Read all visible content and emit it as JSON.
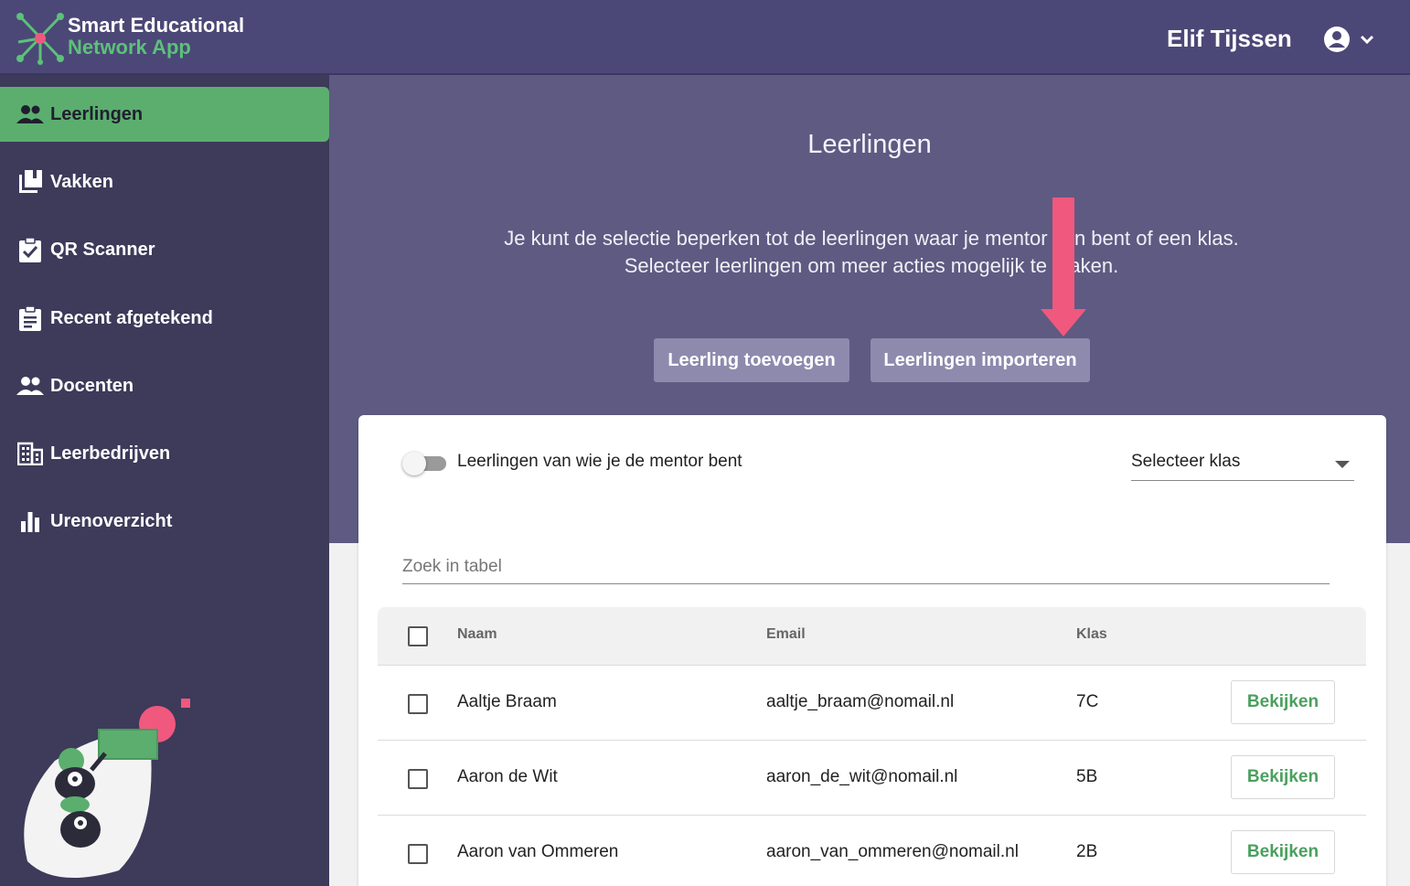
{
  "app": {
    "name_line1": "Smart Educational",
    "name_line2": "Network App",
    "brand_color": "#5cae6e"
  },
  "header": {
    "user_name": "Elif Tijssen",
    "account_icon": "account-circle-icon"
  },
  "sidebar": {
    "items": [
      {
        "label": "Leerlingen",
        "icon": "people-icon",
        "active": true
      },
      {
        "label": "Vakken",
        "icon": "library-books-icon",
        "active": false
      },
      {
        "label": "QR Scanner",
        "icon": "clipboard-check-icon",
        "active": false
      },
      {
        "label": "Recent afgetekend",
        "icon": "clipboard-list-icon",
        "active": false
      },
      {
        "label": "Docenten",
        "icon": "people-icon",
        "active": false
      },
      {
        "label": "Leerbedrijven",
        "icon": "building-icon",
        "active": false
      },
      {
        "label": "Urenoverzicht",
        "icon": "bar-chart-icon",
        "active": false
      }
    ]
  },
  "main": {
    "title": "Leerlingen",
    "description_line1": "Je kunt de selectie beperken tot de leerlingen waar je mentor van bent of een klas.",
    "description_line2": "Selecteer leerlingen om meer acties mogelijk te maken.",
    "add_button": "Leerling toevoegen",
    "import_button": "Leerlingen importeren",
    "mentor_toggle_label": "Leerlingen van wie je de mentor bent",
    "mentor_toggle_on": false,
    "class_select_placeholder": "Selecteer klas",
    "search_placeholder": "Zoek in tabel"
  },
  "table": {
    "columns": [
      "Naam",
      "Email",
      "Klas"
    ],
    "rows": [
      {
        "name": "Aaltje Braam",
        "email": "aaltje_braam@nomail.nl",
        "class": "7C",
        "action": "Bekijken"
      },
      {
        "name": "Aaron de Wit",
        "email": "aaron_de_wit@nomail.nl",
        "class": "5B",
        "action": "Bekijken"
      },
      {
        "name": "Aaron van Ommeren",
        "email": "aaron_van_ommeren@nomail.nl",
        "class": "2B",
        "action": "Bekijken"
      }
    ]
  },
  "annotation": {
    "arrow_color": "#f0587e"
  }
}
